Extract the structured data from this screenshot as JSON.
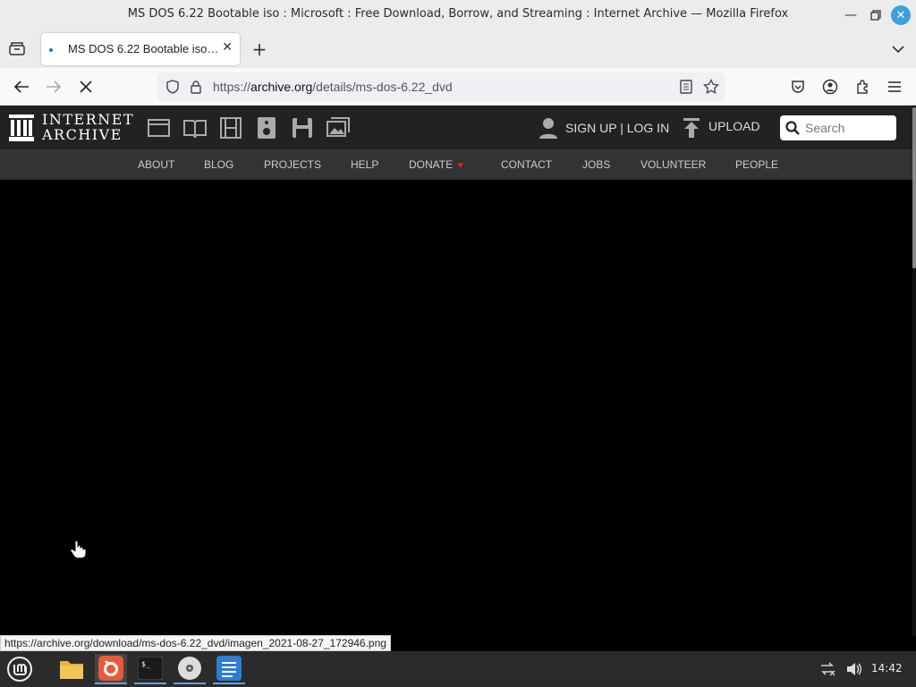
{
  "window": {
    "title": "MS DOS 6.22 Bootable iso : Microsoft : Free Download, Borrow, and Streaming : Internet Archive — Mozilla Firefox",
    "minimize_icon": "minimize-icon",
    "maximize_icon": "maximize-icon",
    "close_icon": "close-icon"
  },
  "tabs": [
    {
      "label": "MS DOS 6.22 Bootable iso : M",
      "active": true
    }
  ],
  "navbar": {
    "url_prefix": "https://",
    "url_domain": "archive.org",
    "url_path": "/details/ms-dos-6.22_dvd"
  },
  "site": {
    "logo_line1": "INTERNET",
    "logo_line2": "ARCHIVE",
    "signup_login": "SIGN UP | LOG IN",
    "upload": "UPLOAD",
    "search_placeholder": "Search",
    "nav_items": [
      "ABOUT",
      "BLOG",
      "PROJECTS",
      "HELP",
      "DONATE",
      "CONTACT",
      "JOBS",
      "VOLUNTEER",
      "PEOPLE"
    ],
    "donate_heart_color": "#e02020"
  },
  "status_url": "https://archive.org/download/ms-dos-6.22_dvd/imagen_2021-08-27_172946.png",
  "taskbar": {
    "clock": "14:42"
  }
}
